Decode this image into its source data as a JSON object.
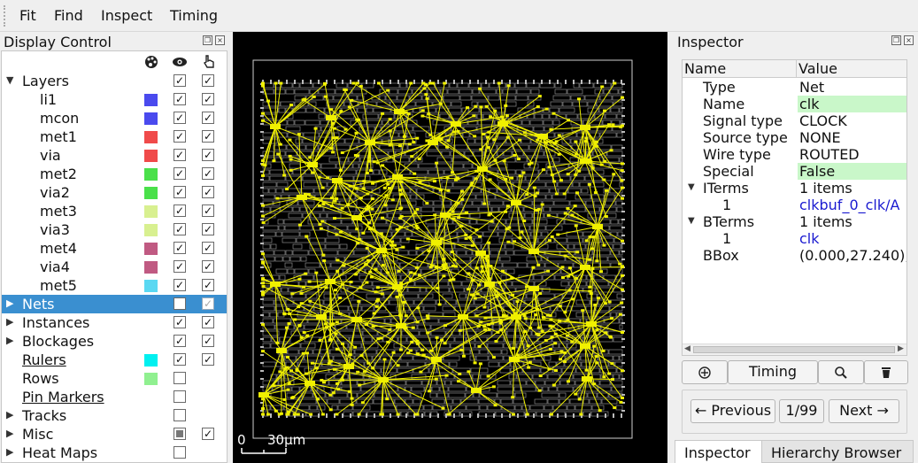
{
  "menu": {
    "items": [
      "Fit",
      "Find",
      "Inspect",
      "Timing"
    ]
  },
  "display_control": {
    "title": "Display Control",
    "header_icons": [
      "palette-icon",
      "eye-icon",
      "pointer-hand-icon"
    ],
    "rows": [
      {
        "label": "Layers",
        "expand": "down",
        "indent": 0,
        "swatch": null,
        "vis": "checked",
        "sel": "checked"
      },
      {
        "label": "li1",
        "indent": 1,
        "swatch": "#4a4aee",
        "vis": "checked",
        "sel": "checked"
      },
      {
        "label": "mcon",
        "indent": 1,
        "swatch": "#4a4aee",
        "vis": "checked",
        "sel": "checked"
      },
      {
        "label": "met1",
        "indent": 1,
        "swatch": "#f04a4a",
        "vis": "checked",
        "sel": "checked"
      },
      {
        "label": "via",
        "indent": 1,
        "swatch": "#f04a4a",
        "vis": "checked",
        "sel": "checked"
      },
      {
        "label": "met2",
        "indent": 1,
        "swatch": "#4ae04a",
        "vis": "checked",
        "sel": "checked"
      },
      {
        "label": "via2",
        "indent": 1,
        "swatch": "#4ae04a",
        "vis": "checked",
        "sel": "checked"
      },
      {
        "label": "met3",
        "indent": 1,
        "swatch": "#d8f090",
        "vis": "checked",
        "sel": "checked"
      },
      {
        "label": "via3",
        "indent": 1,
        "swatch": "#d8f090",
        "vis": "checked",
        "sel": "checked"
      },
      {
        "label": "met4",
        "indent": 1,
        "swatch": "#c05a82",
        "vis": "checked",
        "sel": "checked"
      },
      {
        "label": "via4",
        "indent": 1,
        "swatch": "#c05a82",
        "vis": "checked",
        "sel": "checked"
      },
      {
        "label": "met5",
        "indent": 1,
        "swatch": "#5ad8f2",
        "vis": "checked",
        "sel": "checked"
      },
      {
        "label": "Nets",
        "expand": "right",
        "indent": 0,
        "swatch": null,
        "vis": "unchecked",
        "sel": "checked-dim",
        "selected": true
      },
      {
        "label": "Instances",
        "expand": "right",
        "indent": 0,
        "swatch": null,
        "vis": "checked",
        "sel": "checked"
      },
      {
        "label": "Blockages",
        "expand": "right",
        "indent": 0,
        "swatch": null,
        "vis": "checked",
        "sel": "checked"
      },
      {
        "label": "Rulers",
        "indent": 0,
        "underline": true,
        "swatch": "#00f0f0",
        "vis": "checked",
        "sel": "checked"
      },
      {
        "label": "Rows",
        "indent": 0,
        "swatch": "#90f090",
        "vis": "unchecked",
        "sel": null
      },
      {
        "label": "Pin Markers",
        "indent": 0,
        "underline": true,
        "swatch": null,
        "vis": "unchecked",
        "sel": null
      },
      {
        "label": "Tracks",
        "expand": "right",
        "indent": 0,
        "swatch": null,
        "vis": "unchecked",
        "sel": null
      },
      {
        "label": "Misc",
        "expand": "right",
        "indent": 0,
        "swatch": null,
        "vis": "partial",
        "sel": "checked"
      },
      {
        "label": "Heat Maps",
        "expand": "right",
        "indent": 0,
        "swatch": null,
        "vis": "unchecked",
        "sel": null
      }
    ]
  },
  "layout_view": {
    "scale_start": "0",
    "scale_label": "30µm",
    "highlight_color": "#f0f000"
  },
  "inspector": {
    "title": "Inspector",
    "columns": [
      "Name",
      "Value"
    ],
    "rows": [
      {
        "name": "Type",
        "value": "Net",
        "level": 1
      },
      {
        "name": "Name",
        "value": "clk",
        "level": 1,
        "highlight": true
      },
      {
        "name": "Signal type",
        "value": "CLOCK",
        "level": 1
      },
      {
        "name": "Source type",
        "value": "NONE",
        "level": 1
      },
      {
        "name": "Wire type",
        "value": "ROUTED",
        "level": 1
      },
      {
        "name": "Special",
        "value": "False",
        "level": 1,
        "highlight": true
      },
      {
        "name": "ITerms",
        "value": "1 items",
        "level": 1,
        "expanded": true
      },
      {
        "name": "1",
        "value": "clkbuf_0_clk/A",
        "level": 2,
        "link": true
      },
      {
        "name": "BTerms",
        "value": "1 items",
        "level": 1,
        "expanded": true
      },
      {
        "name": "1",
        "value": "clk",
        "level": 2,
        "link": true
      },
      {
        "name": "BBox",
        "value": "(0.000,27.240),",
        "level": 1
      }
    ],
    "actions": {
      "focus_icon": "crosshair-icon",
      "timing": "Timing",
      "zoom_icon": "zoom-icon",
      "delete_icon": "trash-icon"
    },
    "nav": {
      "previous": "← Previous",
      "counter": "1/99",
      "next": "Next →"
    },
    "tabs": [
      "Inspector",
      "Hierarchy Browser"
    ]
  }
}
